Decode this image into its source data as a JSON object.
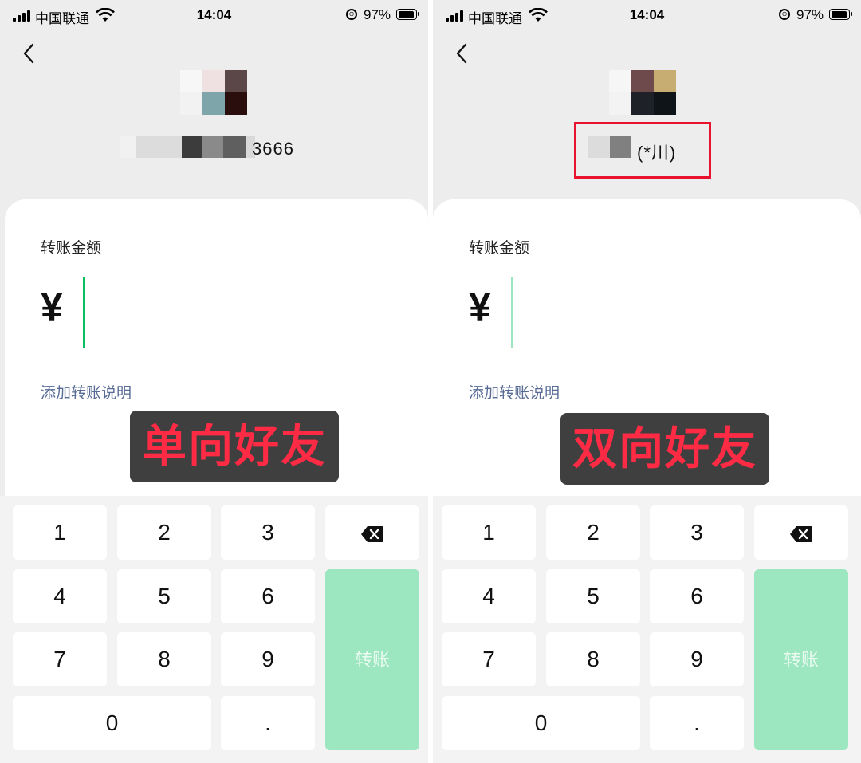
{
  "status_bar": {
    "carrier": "中国联通",
    "time": "14:04",
    "battery": "97%"
  },
  "left_screen": {
    "name_suffix": "3666",
    "tag": "单向好友"
  },
  "right_screen": {
    "name_suffix": "(*川)",
    "tag": "双向好友"
  },
  "form": {
    "amount_label": "转账金额",
    "currency": "¥",
    "add_note": "添加转账说明"
  },
  "keypad": {
    "k1": "1",
    "k2": "2",
    "k3": "3",
    "k4": "4",
    "k5": "5",
    "k6": "6",
    "k7": "7",
    "k8": "8",
    "k9": "9",
    "k0": "0",
    "dot": ".",
    "transfer": "转账"
  },
  "colors": {
    "tag_text": "#ff2b45",
    "tag_bg": "#3f3f3f",
    "link": "#576b95",
    "transfer_button": "#9ce6c0",
    "highlight_box": "#e8132f"
  },
  "icons": [
    "back-icon",
    "backspace-icon",
    "wifi-icon",
    "signal-icon",
    "battery-icon"
  ]
}
